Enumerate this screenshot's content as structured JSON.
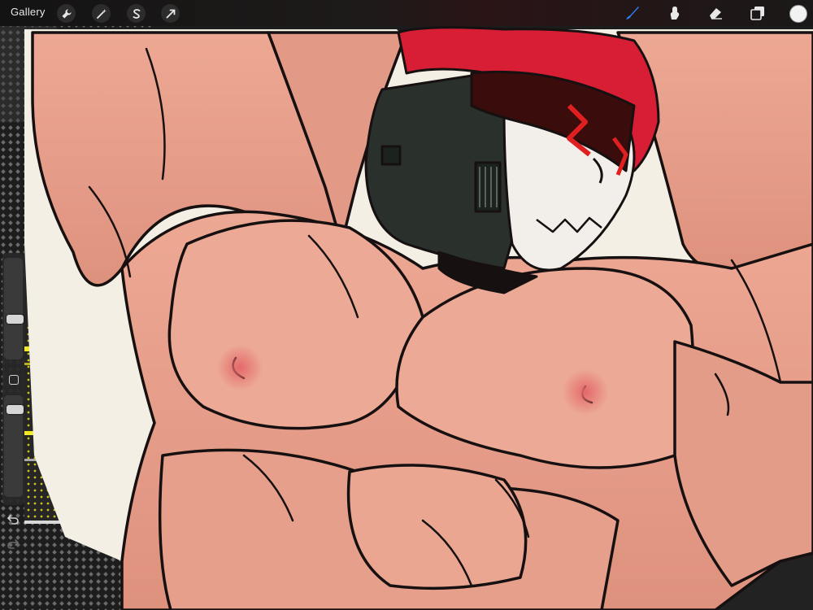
{
  "toolbar": {
    "gallery_label": "Gallery",
    "left_icons": [
      "wrench-icon",
      "magic-wand-icon",
      "selection-s-icon",
      "transform-arrow-icon"
    ],
    "right_tools": [
      "brush-icon",
      "smudge-icon",
      "eraser-icon",
      "layers-icon"
    ],
    "active_tool": "brush",
    "active_tool_color": "#2f7cf6",
    "current_color": "#f2f2f2"
  },
  "sidebar": {
    "brush_size_level": 0.42,
    "opacity_level": 0.78,
    "buttons": [
      "modify-button",
      "undo-button",
      "redo-button"
    ]
  },
  "canvas": {
    "skin_color": "#e8a08c",
    "outline_color": "#161010",
    "bandana_color": "#d81e34",
    "mask_color": "#f2efea",
    "helmet_color": "#2a302c",
    "visor_color": "#3a0c0c",
    "glow_color": "#e8dc1a"
  }
}
